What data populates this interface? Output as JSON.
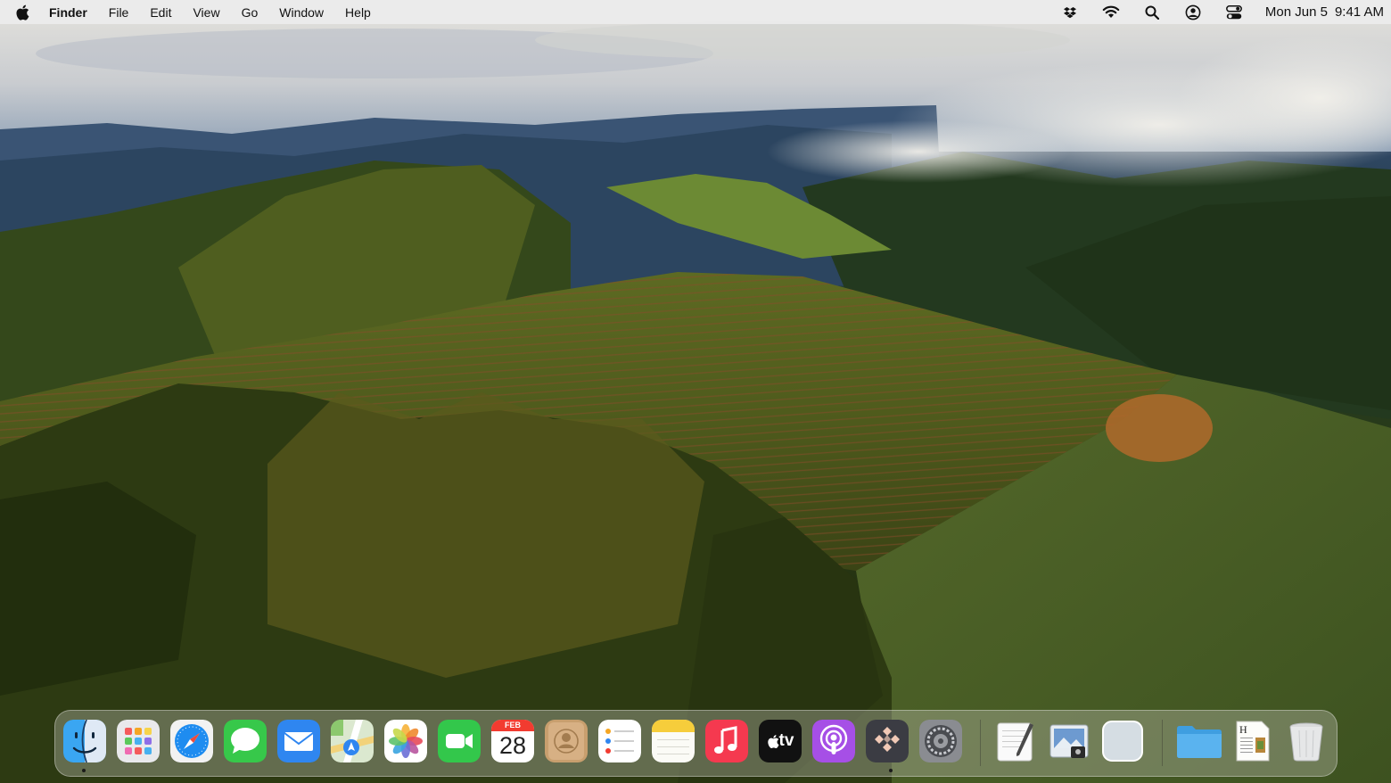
{
  "menubar": {
    "app_name": "Finder",
    "menus": [
      "File",
      "Edit",
      "View",
      "Go",
      "Window",
      "Help"
    ],
    "status_icons": [
      "dropbox-icon",
      "wifi-icon",
      "search-icon",
      "user-account-icon",
      "control-center-icon"
    ],
    "clock": {
      "date": "Mon Jun 5",
      "time": "9:41 AM"
    }
  },
  "dock": {
    "apps": [
      {
        "name": "Finder",
        "icon": "finder-icon",
        "running": true
      },
      {
        "name": "Launchpad",
        "icon": "launchpad-icon",
        "running": false
      },
      {
        "name": "Safari",
        "icon": "safari-icon",
        "running": false
      },
      {
        "name": "Messages",
        "icon": "messages-icon",
        "running": false
      },
      {
        "name": "Mail",
        "icon": "mail-icon",
        "running": false
      },
      {
        "name": "Maps",
        "icon": "maps-icon",
        "running": false
      },
      {
        "name": "Photos",
        "icon": "photos-icon",
        "running": false
      },
      {
        "name": "FaceTime",
        "icon": "facetime-icon",
        "running": false
      },
      {
        "name": "Calendar",
        "icon": "calendar-icon",
        "running": false,
        "month": "FEB",
        "day": "28"
      },
      {
        "name": "Contacts",
        "icon": "contacts-icon",
        "running": false
      },
      {
        "name": "Reminders",
        "icon": "reminders-icon",
        "running": false
      },
      {
        "name": "Notes",
        "icon": "notes-icon",
        "running": false
      },
      {
        "name": "Music",
        "icon": "music-icon",
        "running": false
      },
      {
        "name": "TV",
        "icon": "tv-icon",
        "running": false,
        "label": "tv"
      },
      {
        "name": "Podcasts",
        "icon": "podcasts-icon",
        "running": false
      },
      {
        "name": "App",
        "icon": "diamond-app-icon",
        "running": true
      },
      {
        "name": "System Settings",
        "icon": "system-settings-icon",
        "running": false
      }
    ],
    "documents": [
      {
        "name": "TextEdit",
        "icon": "textedit-icon"
      },
      {
        "name": "Preview",
        "icon": "preview-icon"
      },
      {
        "name": "Blank",
        "icon": "blank-app-icon"
      }
    ],
    "trailing": [
      {
        "name": "Folder",
        "icon": "folder-icon"
      },
      {
        "name": "Document",
        "icon": "document-icon"
      },
      {
        "name": "Trash",
        "icon": "trash-icon"
      }
    ]
  },
  "colors": {
    "menubar_bg": "#ececec",
    "dock_bg": "#bebeaf",
    "running_dot": "#1a1a1a"
  }
}
